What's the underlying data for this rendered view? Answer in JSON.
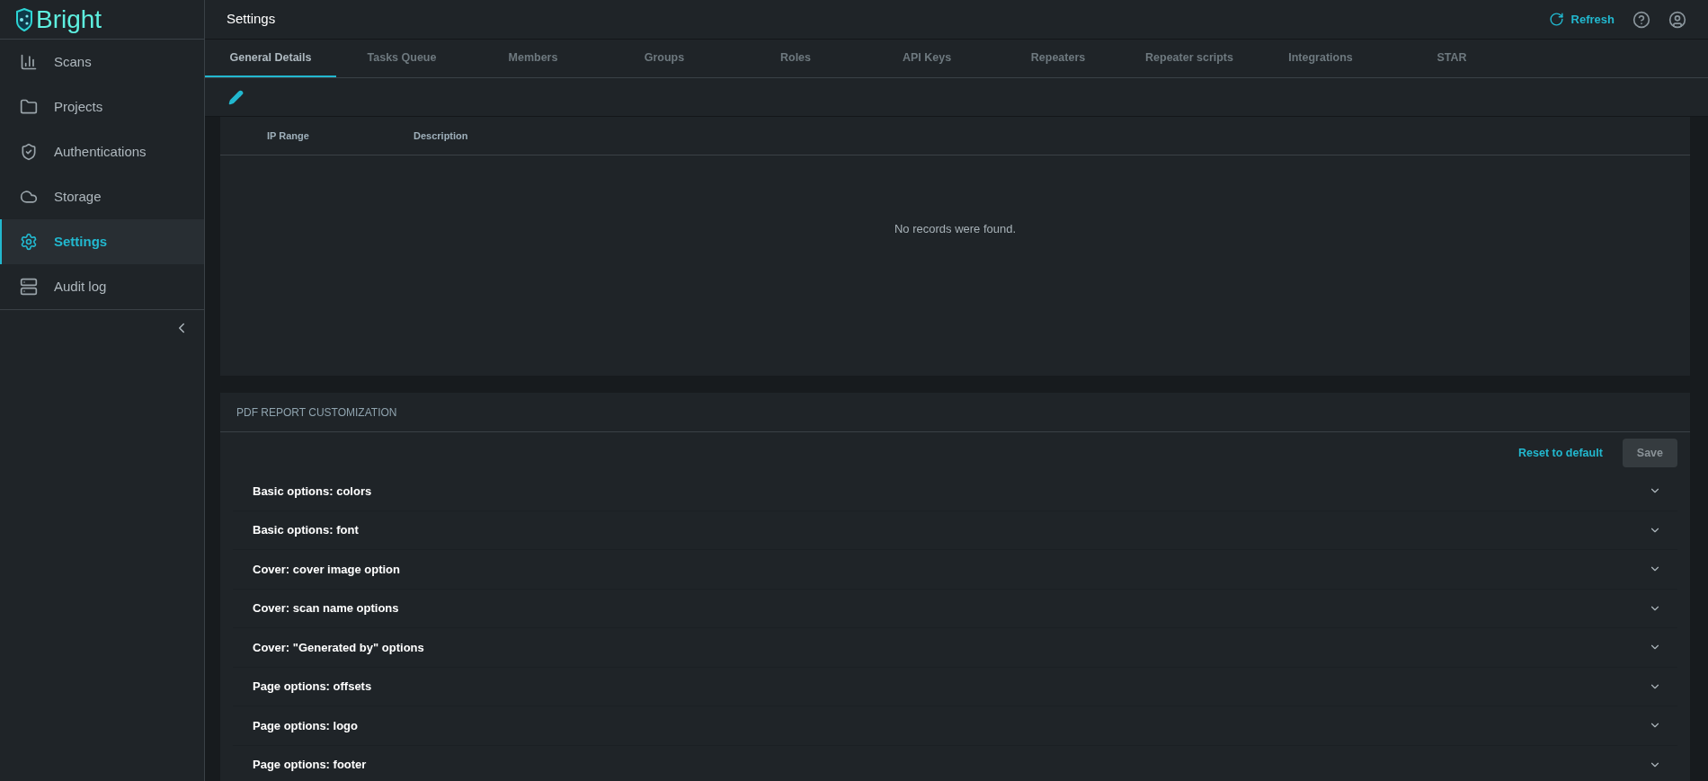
{
  "logo": {
    "text": "Bright"
  },
  "sidebar": {
    "items": [
      {
        "label": "Scans",
        "selected": false
      },
      {
        "label": "Projects",
        "selected": false
      },
      {
        "label": "Authentications",
        "selected": false
      },
      {
        "label": "Storage",
        "selected": false
      },
      {
        "label": "Settings",
        "selected": true
      },
      {
        "label": "Audit log",
        "selected": false
      }
    ]
  },
  "header": {
    "title": "Settings",
    "refresh": "Refresh"
  },
  "tabs": [
    {
      "label": "General Details",
      "selected": true
    },
    {
      "label": "Tasks Queue",
      "selected": false
    },
    {
      "label": "Members",
      "selected": false
    },
    {
      "label": "Groups",
      "selected": false
    },
    {
      "label": "Roles",
      "selected": false
    },
    {
      "label": "API Keys",
      "selected": false
    },
    {
      "label": "Repeaters",
      "selected": false
    },
    {
      "label": "Repeater scripts",
      "selected": false
    },
    {
      "label": "Integrations",
      "selected": false
    },
    {
      "label": "STAR",
      "selected": false
    }
  ],
  "table": {
    "columns": [
      "IP Range",
      "Description"
    ],
    "empty_message": "No records were found."
  },
  "pdf_section": {
    "title": "PDF REPORT CUSTOMIZATION",
    "reset": "Reset to default",
    "save": "Save",
    "save_disabled": true,
    "options": [
      {
        "label": "Basic options: colors",
        "expanded": false
      },
      {
        "label": "Basic options: font",
        "expanded": false
      },
      {
        "label": "Cover: cover image option",
        "expanded": false
      },
      {
        "label": "Cover: scan name options",
        "expanded": false
      },
      {
        "label": "Cover: \"Generated by\" options",
        "expanded": false
      },
      {
        "label": "Page options: offsets",
        "expanded": false
      },
      {
        "label": "Page options: logo",
        "expanded": false
      },
      {
        "label": "Page options: footer",
        "expanded": false
      }
    ]
  }
}
